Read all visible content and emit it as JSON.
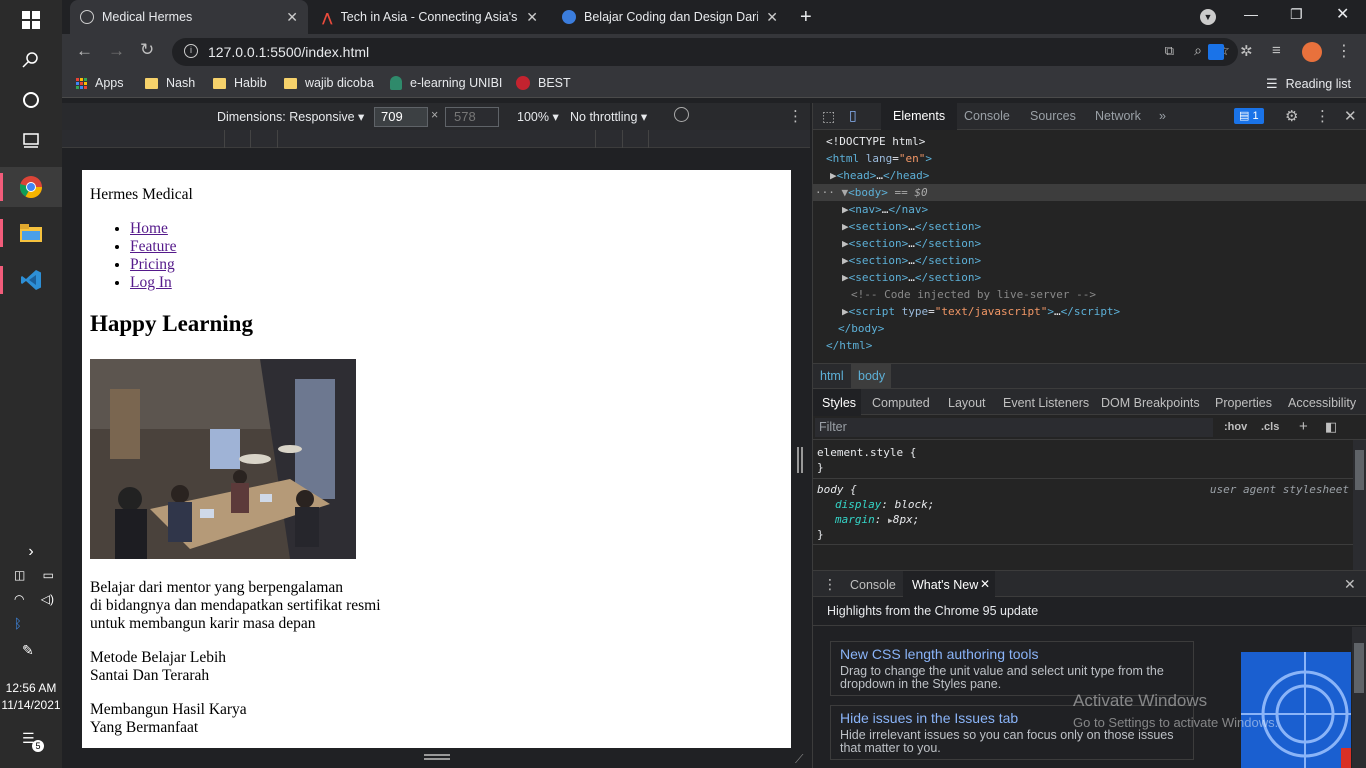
{
  "taskbar": {
    "time": "12:56 AM",
    "date": "11/14/2021",
    "notification_count": "5"
  },
  "browser": {
    "tabs": [
      {
        "title": "Medical Hermes",
        "active": true
      },
      {
        "title": "Tech in Asia - Connecting Asia's s",
        "active": false
      },
      {
        "title": "Belajar Coding dan Design Dari N",
        "active": false
      }
    ],
    "url": "127.0.0.1:5500/index.html",
    "bookmarks": [
      "Apps",
      "Nash",
      "Habib",
      "wajib dicoba",
      "e-learning UNIBI",
      "BEST"
    ],
    "reading_list": "Reading list"
  },
  "device_toolbar": {
    "dimensions": "Dimensions: Responsive",
    "width": "709",
    "height": "578",
    "zoom": "100%",
    "throttling": "No throttling"
  },
  "page": {
    "brand": "Hermes Medical",
    "nav": [
      "Home",
      "Feature",
      "Pricing",
      "Log In"
    ],
    "heading": "Happy Learning",
    "para1": [
      "Belajar dari mentor yang berpengalaman",
      "di bidangnya dan mendapatkan sertifikat resmi",
      "untuk membangun karir masa depan"
    ],
    "para2": [
      "Metode Belajar Lebih",
      "Santai Dan Terarah"
    ],
    "para3": [
      "Membangun Hasil Karya",
      "Yang Bermanfaat"
    ]
  },
  "devtools": {
    "tabs": [
      "Elements",
      "Console",
      "Sources",
      "Network"
    ],
    "issues_count": "1",
    "crumbs": [
      "html",
      "body"
    ],
    "style_tabs": [
      "Styles",
      "Computed",
      "Layout",
      "Event Listeners",
      "DOM Breakpoints",
      "Properties",
      "Accessibility"
    ],
    "filter_placeholder": "Filter",
    "hov": ":hov",
    "cls": ".cls",
    "element_style": "element.style {",
    "body_rule": "body {",
    "ua_label": "user agent stylesheet",
    "decl1_prop": "display",
    "decl1_val": "block;",
    "decl2_prop": "margin",
    "decl2_val": "8px;",
    "drawer_tabs": [
      "Console",
      "What's New"
    ],
    "highlights": "Highlights from the Chrome 95 update",
    "cards": [
      {
        "title": "New CSS length authoring tools",
        "desc": "Drag to change the unit value and select unit type from the dropdown in the Styles pane."
      },
      {
        "title": "Hide issues in the Issues tab",
        "desc": "Hide irrelevant issues so you can focus only on those issues that matter to you."
      }
    ]
  },
  "watermark": {
    "line1": "Activate Windows",
    "line2": "Go to Settings to activate Windows."
  }
}
